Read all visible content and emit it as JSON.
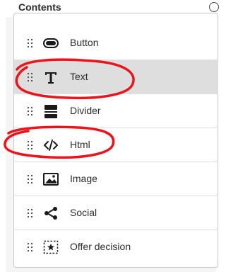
{
  "panel": {
    "title": "Contents",
    "info_icon": "info-icon"
  },
  "items": [
    {
      "label": "Button",
      "icon": "button-icon",
      "selected": false
    },
    {
      "label": "Text",
      "icon": "text-icon",
      "selected": true
    },
    {
      "label": "Divider",
      "icon": "divider-icon",
      "selected": false
    },
    {
      "label": "Html",
      "icon": "code-icon",
      "selected": false
    },
    {
      "label": "Image",
      "icon": "image-icon",
      "selected": false
    },
    {
      "label": "Social",
      "icon": "share-icon",
      "selected": false
    },
    {
      "label": "Offer decision",
      "icon": "offer-decision-icon",
      "selected": false
    }
  ],
  "colors": {
    "selected_background": "#dedede",
    "annotation": "#e8151d"
  },
  "annotations": [
    {
      "type": "hand-drawn-circle",
      "target": "Text"
    },
    {
      "type": "hand-drawn-circle",
      "target": "Html"
    }
  ]
}
